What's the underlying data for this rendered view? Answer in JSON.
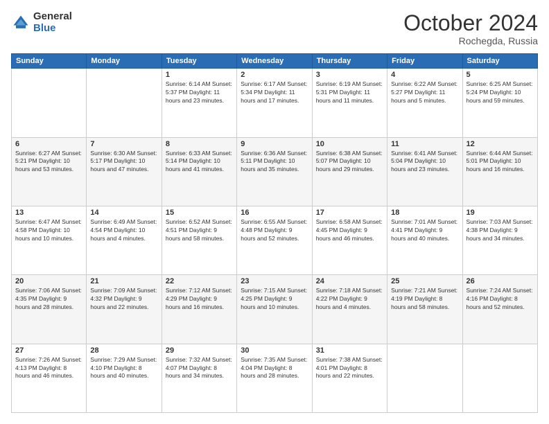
{
  "header": {
    "logo_general": "General",
    "logo_blue": "Blue",
    "month_title": "October 2024",
    "location": "Rochegda, Russia"
  },
  "days_of_week": [
    "Sunday",
    "Monday",
    "Tuesday",
    "Wednesday",
    "Thursday",
    "Friday",
    "Saturday"
  ],
  "weeks": [
    [
      {
        "day": "",
        "info": ""
      },
      {
        "day": "",
        "info": ""
      },
      {
        "day": "1",
        "info": "Sunrise: 6:14 AM\nSunset: 5:37 PM\nDaylight: 11 hours and 23 minutes."
      },
      {
        "day": "2",
        "info": "Sunrise: 6:17 AM\nSunset: 5:34 PM\nDaylight: 11 hours and 17 minutes."
      },
      {
        "day": "3",
        "info": "Sunrise: 6:19 AM\nSunset: 5:31 PM\nDaylight: 11 hours and 11 minutes."
      },
      {
        "day": "4",
        "info": "Sunrise: 6:22 AM\nSunset: 5:27 PM\nDaylight: 11 hours and 5 minutes."
      },
      {
        "day": "5",
        "info": "Sunrise: 6:25 AM\nSunset: 5:24 PM\nDaylight: 10 hours and 59 minutes."
      }
    ],
    [
      {
        "day": "6",
        "info": "Sunrise: 6:27 AM\nSunset: 5:21 PM\nDaylight: 10 hours and 53 minutes."
      },
      {
        "day": "7",
        "info": "Sunrise: 6:30 AM\nSunset: 5:17 PM\nDaylight: 10 hours and 47 minutes."
      },
      {
        "day": "8",
        "info": "Sunrise: 6:33 AM\nSunset: 5:14 PM\nDaylight: 10 hours and 41 minutes."
      },
      {
        "day": "9",
        "info": "Sunrise: 6:36 AM\nSunset: 5:11 PM\nDaylight: 10 hours and 35 minutes."
      },
      {
        "day": "10",
        "info": "Sunrise: 6:38 AM\nSunset: 5:07 PM\nDaylight: 10 hours and 29 minutes."
      },
      {
        "day": "11",
        "info": "Sunrise: 6:41 AM\nSunset: 5:04 PM\nDaylight: 10 hours and 23 minutes."
      },
      {
        "day": "12",
        "info": "Sunrise: 6:44 AM\nSunset: 5:01 PM\nDaylight: 10 hours and 16 minutes."
      }
    ],
    [
      {
        "day": "13",
        "info": "Sunrise: 6:47 AM\nSunset: 4:58 PM\nDaylight: 10 hours and 10 minutes."
      },
      {
        "day": "14",
        "info": "Sunrise: 6:49 AM\nSunset: 4:54 PM\nDaylight: 10 hours and 4 minutes."
      },
      {
        "day": "15",
        "info": "Sunrise: 6:52 AM\nSunset: 4:51 PM\nDaylight: 9 hours and 58 minutes."
      },
      {
        "day": "16",
        "info": "Sunrise: 6:55 AM\nSunset: 4:48 PM\nDaylight: 9 hours and 52 minutes."
      },
      {
        "day": "17",
        "info": "Sunrise: 6:58 AM\nSunset: 4:45 PM\nDaylight: 9 hours and 46 minutes."
      },
      {
        "day": "18",
        "info": "Sunrise: 7:01 AM\nSunset: 4:41 PM\nDaylight: 9 hours and 40 minutes."
      },
      {
        "day": "19",
        "info": "Sunrise: 7:03 AM\nSunset: 4:38 PM\nDaylight: 9 hours and 34 minutes."
      }
    ],
    [
      {
        "day": "20",
        "info": "Sunrise: 7:06 AM\nSunset: 4:35 PM\nDaylight: 9 hours and 28 minutes."
      },
      {
        "day": "21",
        "info": "Sunrise: 7:09 AM\nSunset: 4:32 PM\nDaylight: 9 hours and 22 minutes."
      },
      {
        "day": "22",
        "info": "Sunrise: 7:12 AM\nSunset: 4:29 PM\nDaylight: 9 hours and 16 minutes."
      },
      {
        "day": "23",
        "info": "Sunrise: 7:15 AM\nSunset: 4:25 PM\nDaylight: 9 hours and 10 minutes."
      },
      {
        "day": "24",
        "info": "Sunrise: 7:18 AM\nSunset: 4:22 PM\nDaylight: 9 hours and 4 minutes."
      },
      {
        "day": "25",
        "info": "Sunrise: 7:21 AM\nSunset: 4:19 PM\nDaylight: 8 hours and 58 minutes."
      },
      {
        "day": "26",
        "info": "Sunrise: 7:24 AM\nSunset: 4:16 PM\nDaylight: 8 hours and 52 minutes."
      }
    ],
    [
      {
        "day": "27",
        "info": "Sunrise: 7:26 AM\nSunset: 4:13 PM\nDaylight: 8 hours and 46 minutes."
      },
      {
        "day": "28",
        "info": "Sunrise: 7:29 AM\nSunset: 4:10 PM\nDaylight: 8 hours and 40 minutes."
      },
      {
        "day": "29",
        "info": "Sunrise: 7:32 AM\nSunset: 4:07 PM\nDaylight: 8 hours and 34 minutes."
      },
      {
        "day": "30",
        "info": "Sunrise: 7:35 AM\nSunset: 4:04 PM\nDaylight: 8 hours and 28 minutes."
      },
      {
        "day": "31",
        "info": "Sunrise: 7:38 AM\nSunset: 4:01 PM\nDaylight: 8 hours and 22 minutes."
      },
      {
        "day": "",
        "info": ""
      },
      {
        "day": "",
        "info": ""
      }
    ]
  ]
}
